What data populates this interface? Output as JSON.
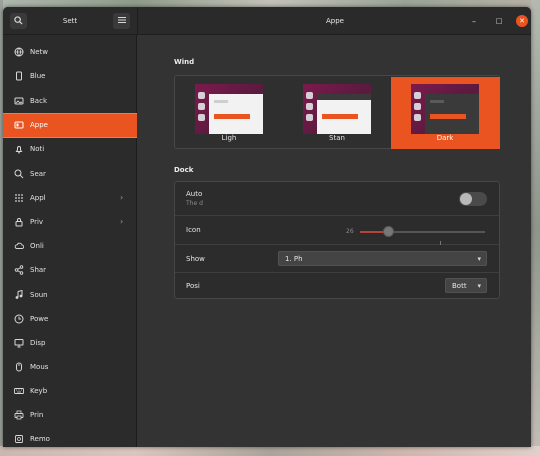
{
  "sidebar": {
    "title": "Sett",
    "items": [
      {
        "label": "Netw",
        "icon": "network-icon"
      },
      {
        "label": "Blue",
        "icon": "bluetooth-icon"
      },
      {
        "label": "Back",
        "icon": "background-icon"
      },
      {
        "label": "Appe",
        "icon": "appearance-icon",
        "active": true
      },
      {
        "label": "Noti",
        "icon": "notifications-icon"
      },
      {
        "label": "Sear",
        "icon": "search-icon"
      },
      {
        "label": "Appl",
        "icon": "applications-icon",
        "chevron": true
      },
      {
        "label": "Priv",
        "icon": "privacy-icon",
        "chevron": true
      },
      {
        "label": "Onli",
        "icon": "online-accounts-icon"
      },
      {
        "label": "Shar",
        "icon": "sharing-icon"
      },
      {
        "label": "Soun",
        "icon": "sound-icon"
      },
      {
        "label": "Powe",
        "icon": "power-icon"
      },
      {
        "label": "Disp",
        "icon": "displays-icon"
      },
      {
        "label": "Mous",
        "icon": "mouse-icon"
      },
      {
        "label": "Keyb",
        "icon": "keyboard-icon"
      },
      {
        "label": "Prin",
        "icon": "printers-icon"
      },
      {
        "label": "Remo",
        "icon": "removable-media-icon"
      }
    ]
  },
  "header": {
    "title": "Appe",
    "search_icon": "search-icon",
    "menu_icon": "hamburger-menu-icon"
  },
  "window_controls": {
    "minimize": "–",
    "maximize": "□",
    "close": "✕"
  },
  "window_colors": {
    "section_title": "Wind",
    "themes": [
      {
        "label": "Ligh",
        "selected": false
      },
      {
        "label": "Stan",
        "selected": false
      },
      {
        "label": "Dark",
        "selected": true
      }
    ]
  },
  "dock": {
    "section_title": "Dock",
    "auto_hide": {
      "label": "Auto",
      "sublabel": "The d",
      "enabled": false
    },
    "icon_size": {
      "label": "Icon",
      "value_text": "26",
      "level": 0.22
    },
    "show_on": {
      "label": "Show",
      "value": "1. Ph"
    },
    "position": {
      "label": "Posi",
      "value": "Bott"
    }
  },
  "colors": {
    "accent": "#e95420",
    "window_bg": "#303030",
    "sidebar_bg": "#2b2b2b"
  }
}
